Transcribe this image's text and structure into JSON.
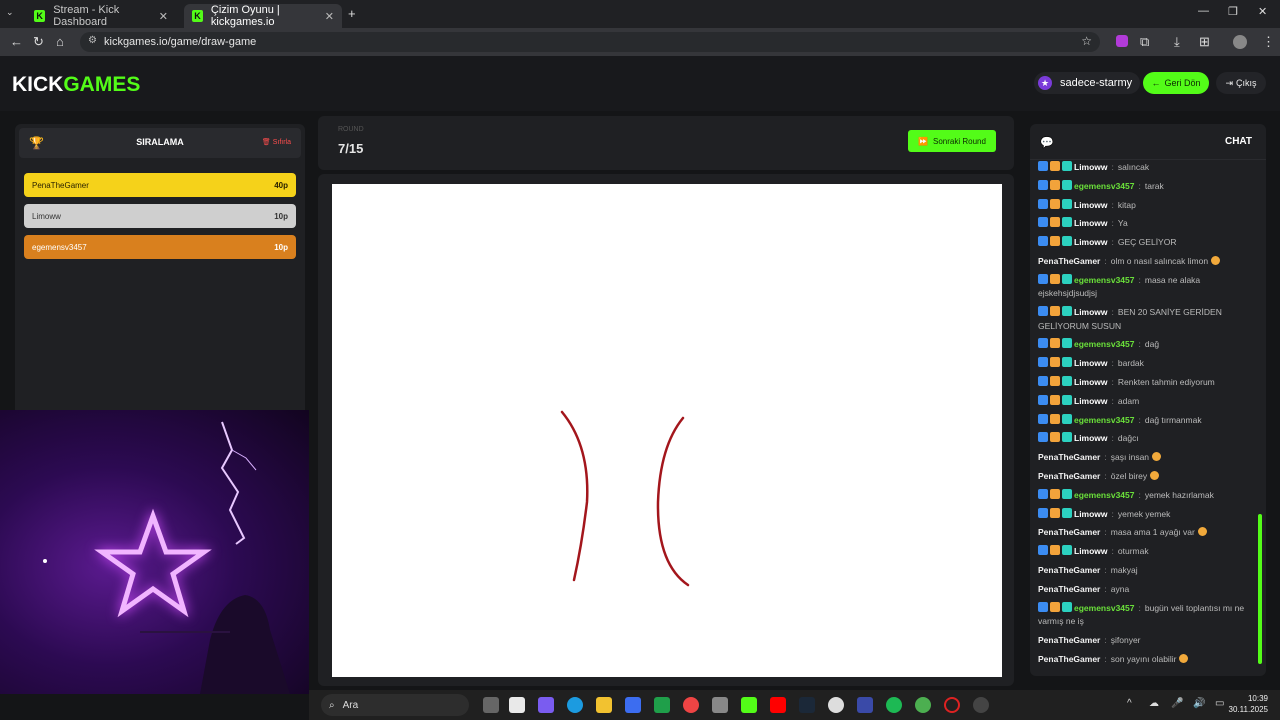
{
  "browser": {
    "tabs": [
      {
        "label": "Stream - Kick Dashboard",
        "active": false
      },
      {
        "label": "Çizim Oyunu | kickgames.io",
        "active": true
      }
    ],
    "url": "kickgames.io/game/draw-game"
  },
  "site": {
    "logo_a": "KICK",
    "logo_b": "GAMES",
    "username": "sadece-starmy",
    "back_label": "Geri Dön",
    "logout_label": "Çıkış"
  },
  "ranking": {
    "title": "SIRALAMA",
    "reset_label": "Sıfırla",
    "rows": [
      {
        "name": "PenaTheGamer",
        "points": "40p"
      },
      {
        "name": "Limoww",
        "points": "10p"
      },
      {
        "name": "egemensv3457",
        "points": "10p"
      }
    ]
  },
  "round": {
    "small_label": "ROUND",
    "value": "7/15",
    "next_label": "Sonraki Round"
  },
  "chat": {
    "title": "CHAT",
    "messages": [
      {
        "user": "Limoww",
        "text": "salıncak",
        "badges": true
      },
      {
        "user": "egemensv3457",
        "text": "tarak",
        "badges": true
      },
      {
        "user": "Limoww",
        "text": "kitap",
        "badges": true
      },
      {
        "user": "Limoww",
        "text": "Ya",
        "badges": true
      },
      {
        "user": "Limoww",
        "text": "GEÇ GELİYOR",
        "badges": true
      },
      {
        "user": "PenaTheGamer",
        "text": "olm o nasıl salıncak limon",
        "badges": false,
        "emoji": true
      },
      {
        "user": "egemensv3457",
        "text": "masa ne alaka ejskehsjdjsudjsj",
        "badges": true
      },
      {
        "user": "Limoww",
        "text": "BEN 20 SANİYE GERİDEN GELİYORUM SUSUN",
        "badges": true
      },
      {
        "user": "egemensv3457",
        "text": "dağ",
        "badges": true
      },
      {
        "user": "Limoww",
        "text": "bardak",
        "badges": true
      },
      {
        "user": "Limoww",
        "text": "Renkten tahmin ediyorum",
        "badges": true
      },
      {
        "user": "Limoww",
        "text": "adam",
        "badges": true
      },
      {
        "user": "egemensv3457",
        "text": "dağ tırmanmak",
        "badges": true
      },
      {
        "user": "Limoww",
        "text": "dağcı",
        "badges": true
      },
      {
        "user": "PenaTheGamer",
        "text": "şaşı insan",
        "badges": false,
        "emoji": true
      },
      {
        "user": "PenaTheGamer",
        "text": "özel birey",
        "badges": false,
        "emoji": true
      },
      {
        "user": "egemensv3457",
        "text": "yemek hazırlamak",
        "badges": true
      },
      {
        "user": "Limoww",
        "text": "yemek yemek",
        "badges": true
      },
      {
        "user": "PenaTheGamer",
        "text": "masa ama 1 ayağı var",
        "badges": false,
        "emoji": true
      },
      {
        "user": "Limoww",
        "text": "oturmak",
        "badges": true
      },
      {
        "user": "PenaTheGamer",
        "text": "makyaj",
        "badges": false
      },
      {
        "user": "PenaTheGamer",
        "text": "ayna",
        "badges": false
      },
      {
        "user": "egemensv3457",
        "text": "bugün veli toplantısı mı ne varmış ne iş",
        "badges": true
      },
      {
        "user": "PenaTheGamer",
        "text": "şifonyer",
        "badges": false
      },
      {
        "user": "PenaTheGamer",
        "text": "son yayını olabilir",
        "badges": false,
        "emoji": true
      }
    ]
  },
  "taskbar": {
    "search_label": "Ara",
    "time": "10:39",
    "date": "30.11.2025"
  },
  "colors": {
    "brand_green": "#53fc18",
    "rank_gold": "#f5d21a",
    "rank_silver": "#cfcfcf",
    "rank_bronze": "#d9801e",
    "user_limoww": "#ffffff",
    "user_egemen": "#6ae03a",
    "user_pena": "#f2f2f2",
    "stroke": "#a3161c"
  }
}
